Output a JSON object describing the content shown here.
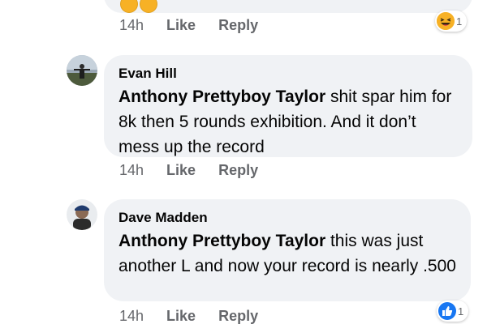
{
  "comments": [
    {
      "actions": {
        "time": "14h",
        "like": "Like",
        "reply": "Reply"
      },
      "reaction": {
        "icon": "haha-icon",
        "count": "1"
      }
    },
    {
      "author": "Evan Hill",
      "mention": "Anthony Prettyboy Taylor",
      "text": " shit spar him for 8k then 5 rounds exhibition. And it don’t mess up the record",
      "actions": {
        "time": "14h",
        "like": "Like",
        "reply": "Reply"
      }
    },
    {
      "author": "Dave Madden",
      "mention": "Anthony Prettyboy Taylor",
      "text": " this was just another L and now your record is nearly .500",
      "actions": {
        "time": "14h",
        "like": "Like",
        "reply": "Reply"
      },
      "reaction": {
        "icon": "like-icon",
        "count": "1"
      }
    }
  ],
  "colors": {
    "bubble": "#f0f2f5",
    "meta_text": "#65676b",
    "like_blue": "#1877f2",
    "haha_yellow": "#f7b125"
  }
}
